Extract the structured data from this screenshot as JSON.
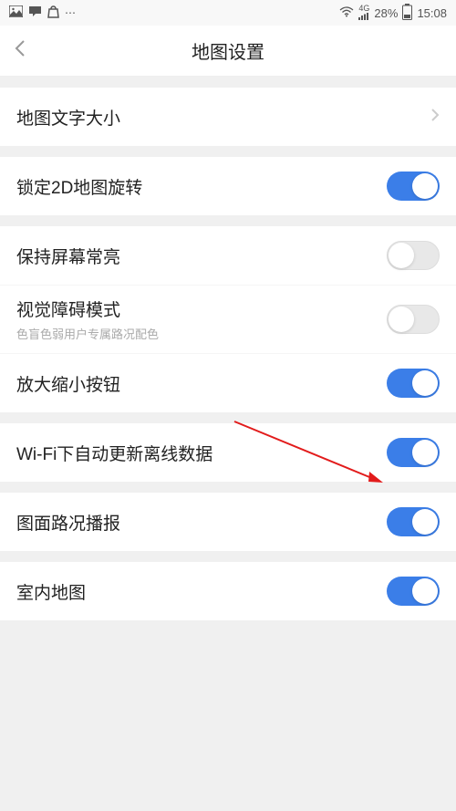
{
  "status_bar": {
    "battery_percent": "28%",
    "time": "15:08",
    "network": "4G"
  },
  "header": {
    "title": "地图设置"
  },
  "settings": {
    "text_size": {
      "label": "地图文字大小"
    },
    "lock_2d_rotation": {
      "label": "锁定2D地图旋转",
      "enabled": true
    },
    "keep_screen_on": {
      "label": "保持屏幕常亮",
      "enabled": false
    },
    "accessibility_mode": {
      "label": "视觉障碍模式",
      "subtitle": "色盲色弱用户专属路况配色",
      "enabled": false
    },
    "zoom_buttons": {
      "label": "放大缩小按钮",
      "enabled": true
    },
    "wifi_auto_update": {
      "label": "Wi-Fi下自动更新离线数据",
      "enabled": true
    },
    "traffic_broadcast": {
      "label": "图面路况播报",
      "enabled": true
    },
    "indoor_map": {
      "label": "室内地图",
      "enabled": true
    }
  }
}
